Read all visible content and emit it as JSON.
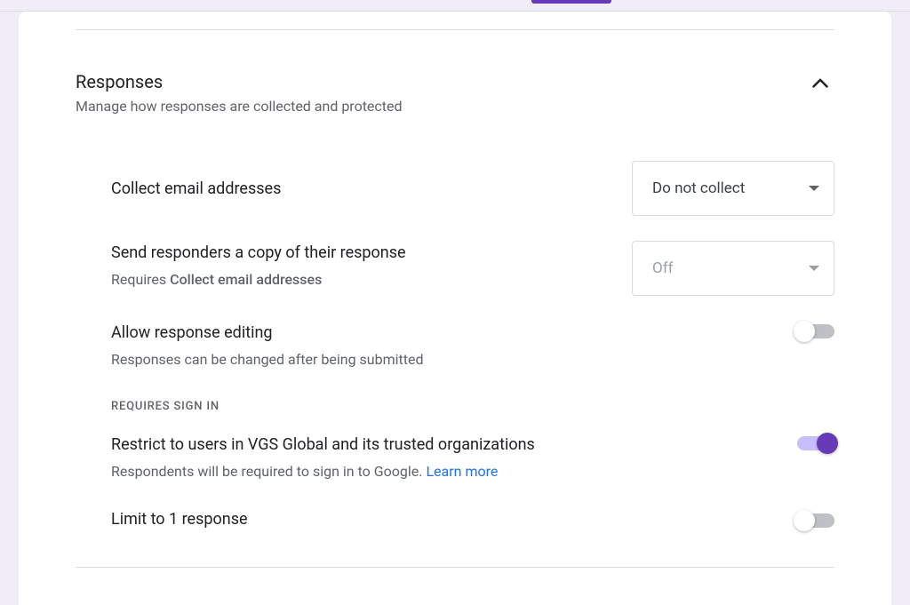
{
  "section": {
    "title": "Responses",
    "subtitle": "Manage how responses are collected and protected"
  },
  "collectEmail": {
    "label": "Collect email addresses",
    "selected": "Do not collect"
  },
  "sendCopy": {
    "label": "Send responders a copy of their response",
    "requiresPrefix": "Requires ",
    "requiresBold": "Collect email addresses",
    "selected": "Off"
  },
  "allowEdit": {
    "label": "Allow response editing",
    "desc": "Responses can be changed after being submitted"
  },
  "subsection": {
    "label": "Requires sign in"
  },
  "restrict": {
    "label": "Restrict to users in VGS Global and its trusted organizations",
    "descPrefix": "Respondents will be required to sign in to Google. ",
    "learnMore": "Learn more"
  },
  "limit": {
    "label": "Limit to 1 response"
  }
}
